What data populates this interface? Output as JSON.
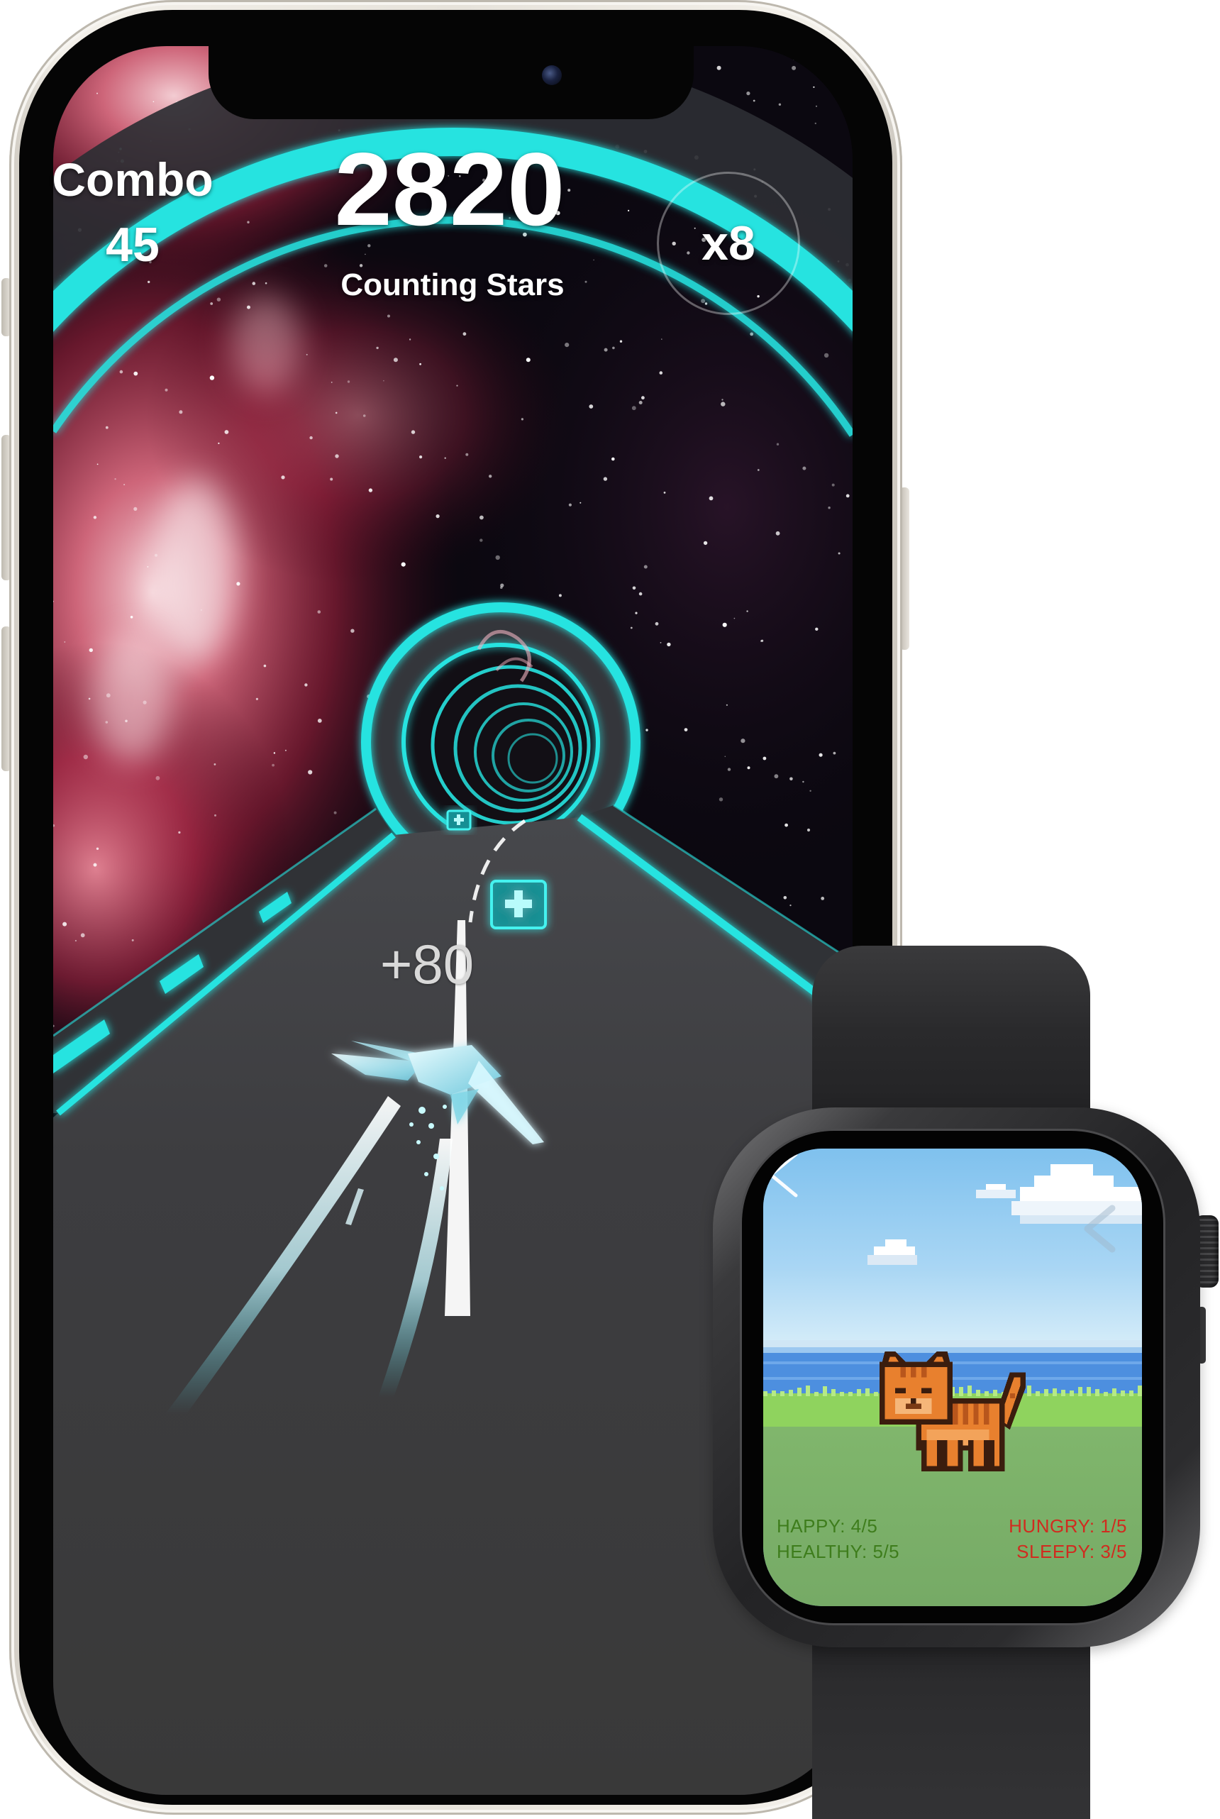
{
  "game": {
    "combo_label": "Combo",
    "combo_value": "45",
    "score": "2820",
    "song_title": "Counting Stars",
    "multiplier": "x8",
    "score_popup": "+80"
  },
  "watch": {
    "stats_left": [
      "HAPPY: 4/5",
      "HEALTHY: 5/5"
    ],
    "stats_right": [
      "HUNGRY: 1/5",
      "SLEEPY: 3/5"
    ],
    "back_icon": "chevron-left-icon"
  },
  "colors": {
    "neon": "#27e3e0",
    "road": "#3b3b3d",
    "stat_good": "#3e7d1c",
    "stat_bad": "#d12b1f",
    "sky": "#86c6ef"
  }
}
